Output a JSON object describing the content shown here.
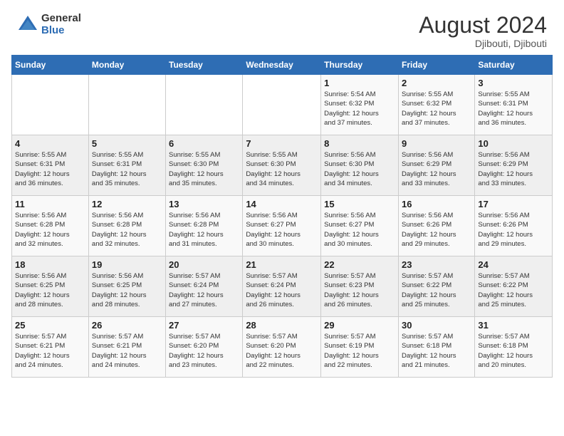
{
  "logo": {
    "general": "General",
    "blue": "Blue"
  },
  "title": {
    "month_year": "August 2024",
    "location": "Djibouti, Djibouti"
  },
  "days_of_week": [
    "Sunday",
    "Monday",
    "Tuesday",
    "Wednesday",
    "Thursday",
    "Friday",
    "Saturday"
  ],
  "weeks": [
    [
      {
        "num": "",
        "info": ""
      },
      {
        "num": "",
        "info": ""
      },
      {
        "num": "",
        "info": ""
      },
      {
        "num": "",
        "info": ""
      },
      {
        "num": "1",
        "info": "Sunrise: 5:54 AM\nSunset: 6:32 PM\nDaylight: 12 hours\nand 37 minutes."
      },
      {
        "num": "2",
        "info": "Sunrise: 5:55 AM\nSunset: 6:32 PM\nDaylight: 12 hours\nand 37 minutes."
      },
      {
        "num": "3",
        "info": "Sunrise: 5:55 AM\nSunset: 6:31 PM\nDaylight: 12 hours\nand 36 minutes."
      }
    ],
    [
      {
        "num": "4",
        "info": "Sunrise: 5:55 AM\nSunset: 6:31 PM\nDaylight: 12 hours\nand 36 minutes."
      },
      {
        "num": "5",
        "info": "Sunrise: 5:55 AM\nSunset: 6:31 PM\nDaylight: 12 hours\nand 35 minutes."
      },
      {
        "num": "6",
        "info": "Sunrise: 5:55 AM\nSunset: 6:30 PM\nDaylight: 12 hours\nand 35 minutes."
      },
      {
        "num": "7",
        "info": "Sunrise: 5:55 AM\nSunset: 6:30 PM\nDaylight: 12 hours\nand 34 minutes."
      },
      {
        "num": "8",
        "info": "Sunrise: 5:56 AM\nSunset: 6:30 PM\nDaylight: 12 hours\nand 34 minutes."
      },
      {
        "num": "9",
        "info": "Sunrise: 5:56 AM\nSunset: 6:29 PM\nDaylight: 12 hours\nand 33 minutes."
      },
      {
        "num": "10",
        "info": "Sunrise: 5:56 AM\nSunset: 6:29 PM\nDaylight: 12 hours\nand 33 minutes."
      }
    ],
    [
      {
        "num": "11",
        "info": "Sunrise: 5:56 AM\nSunset: 6:28 PM\nDaylight: 12 hours\nand 32 minutes."
      },
      {
        "num": "12",
        "info": "Sunrise: 5:56 AM\nSunset: 6:28 PM\nDaylight: 12 hours\nand 32 minutes."
      },
      {
        "num": "13",
        "info": "Sunrise: 5:56 AM\nSunset: 6:28 PM\nDaylight: 12 hours\nand 31 minutes."
      },
      {
        "num": "14",
        "info": "Sunrise: 5:56 AM\nSunset: 6:27 PM\nDaylight: 12 hours\nand 30 minutes."
      },
      {
        "num": "15",
        "info": "Sunrise: 5:56 AM\nSunset: 6:27 PM\nDaylight: 12 hours\nand 30 minutes."
      },
      {
        "num": "16",
        "info": "Sunrise: 5:56 AM\nSunset: 6:26 PM\nDaylight: 12 hours\nand 29 minutes."
      },
      {
        "num": "17",
        "info": "Sunrise: 5:56 AM\nSunset: 6:26 PM\nDaylight: 12 hours\nand 29 minutes."
      }
    ],
    [
      {
        "num": "18",
        "info": "Sunrise: 5:56 AM\nSunset: 6:25 PM\nDaylight: 12 hours\nand 28 minutes."
      },
      {
        "num": "19",
        "info": "Sunrise: 5:56 AM\nSunset: 6:25 PM\nDaylight: 12 hours\nand 28 minutes."
      },
      {
        "num": "20",
        "info": "Sunrise: 5:57 AM\nSunset: 6:24 PM\nDaylight: 12 hours\nand 27 minutes."
      },
      {
        "num": "21",
        "info": "Sunrise: 5:57 AM\nSunset: 6:24 PM\nDaylight: 12 hours\nand 26 minutes."
      },
      {
        "num": "22",
        "info": "Sunrise: 5:57 AM\nSunset: 6:23 PM\nDaylight: 12 hours\nand 26 minutes."
      },
      {
        "num": "23",
        "info": "Sunrise: 5:57 AM\nSunset: 6:22 PM\nDaylight: 12 hours\nand 25 minutes."
      },
      {
        "num": "24",
        "info": "Sunrise: 5:57 AM\nSunset: 6:22 PM\nDaylight: 12 hours\nand 25 minutes."
      }
    ],
    [
      {
        "num": "25",
        "info": "Sunrise: 5:57 AM\nSunset: 6:21 PM\nDaylight: 12 hours\nand 24 minutes."
      },
      {
        "num": "26",
        "info": "Sunrise: 5:57 AM\nSunset: 6:21 PM\nDaylight: 12 hours\nand 24 minutes."
      },
      {
        "num": "27",
        "info": "Sunrise: 5:57 AM\nSunset: 6:20 PM\nDaylight: 12 hours\nand 23 minutes."
      },
      {
        "num": "28",
        "info": "Sunrise: 5:57 AM\nSunset: 6:20 PM\nDaylight: 12 hours\nand 22 minutes."
      },
      {
        "num": "29",
        "info": "Sunrise: 5:57 AM\nSunset: 6:19 PM\nDaylight: 12 hours\nand 22 minutes."
      },
      {
        "num": "30",
        "info": "Sunrise: 5:57 AM\nSunset: 6:18 PM\nDaylight: 12 hours\nand 21 minutes."
      },
      {
        "num": "31",
        "info": "Sunrise: 5:57 AM\nSunset: 6:18 PM\nDaylight: 12 hours\nand 20 minutes."
      }
    ]
  ]
}
